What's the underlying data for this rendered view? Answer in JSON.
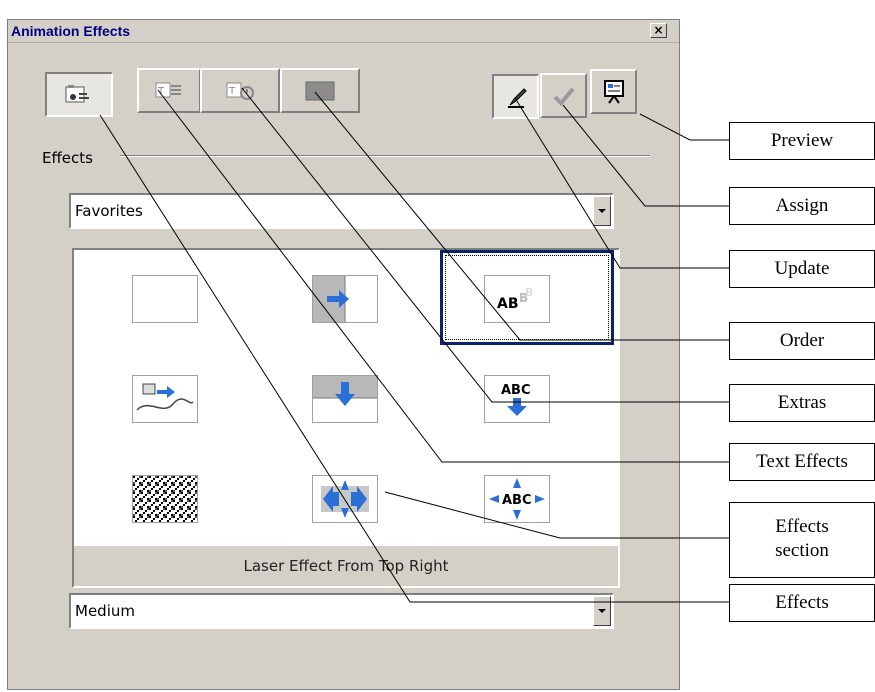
{
  "dialog": {
    "title": "Animation Effects",
    "close_glyph": "×"
  },
  "toolbar": {
    "left_buttons": [
      {
        "name": "effects",
        "icon": "effects-icon",
        "pressed": true
      },
      {
        "name": "text-effects",
        "icon": "text-effects-icon",
        "pressed": false
      },
      {
        "name": "extras",
        "icon": "extras-icon",
        "pressed": false
      },
      {
        "name": "order",
        "icon": "order-icon",
        "pressed": false
      }
    ],
    "right_buttons": [
      {
        "name": "update",
        "icon": "update-icon",
        "pressed": true
      },
      {
        "name": "assign",
        "icon": "assign-icon",
        "pressed": false
      },
      {
        "name": "preview",
        "icon": "preview-icon",
        "pressed": false
      }
    ]
  },
  "effects_section": {
    "label": "Effects",
    "category_value": "Favorites",
    "speed_value": "Medium",
    "status_text": "Laser Effect From Top Right",
    "selected_index": 2,
    "cells": [
      {
        "icon": "blank-effect-icon"
      },
      {
        "icon": "fly-in-right-icon"
      },
      {
        "icon": "laser-text-icon",
        "text": "AB"
      },
      {
        "icon": "move-along-curve-icon"
      },
      {
        "icon": "fly-in-top-icon"
      },
      {
        "icon": "text-drop-icon",
        "text": "ABC"
      },
      {
        "icon": "dissolve-icon"
      },
      {
        "icon": "spiral-icon"
      },
      {
        "icon": "text-spread-icon",
        "text": "ABC"
      }
    ]
  },
  "callouts": [
    {
      "label": "Preview"
    },
    {
      "label": "Assign"
    },
    {
      "label": "Update"
    },
    {
      "label": "Order"
    },
    {
      "label": "Extras"
    },
    {
      "label": "Text Effects"
    },
    {
      "label": "Effects section",
      "line1": "Effects",
      "line2": "section"
    },
    {
      "label": "Effects"
    }
  ],
  "colors": {
    "dialog_bg": "#d4d0c8",
    "title_text": "#000080",
    "selection": "#0a246a",
    "arrow_blue": "#2a6fd6"
  }
}
